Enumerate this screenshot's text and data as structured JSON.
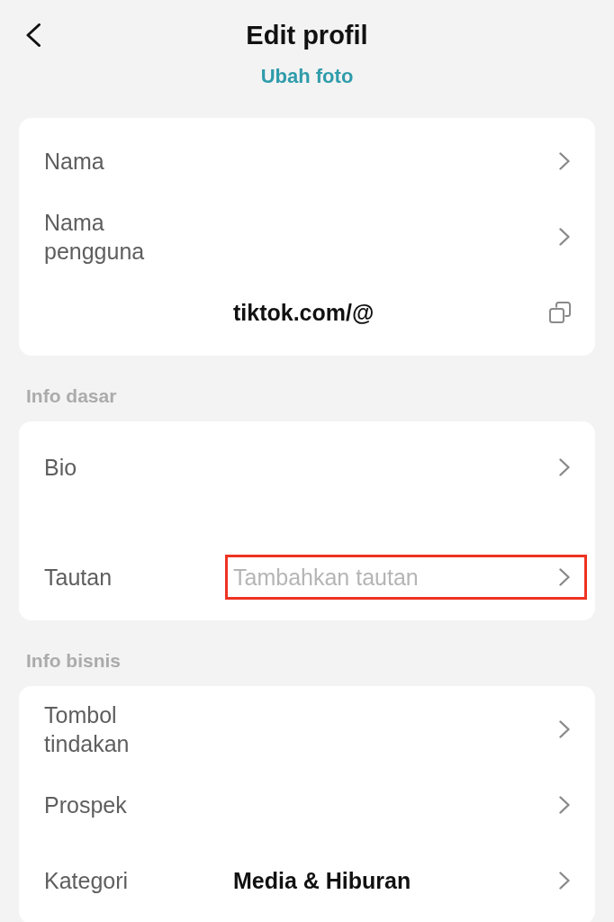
{
  "header": {
    "title": "Edit profil"
  },
  "photo_link": {
    "label": "Ubah foto"
  },
  "sections": [
    {
      "rows": [
        {
          "kind": "nav",
          "label": "Nama",
          "highlighted": false
        },
        {
          "kind": "nav",
          "label": "Nama pengguna",
          "highlighted": false
        },
        {
          "kind": "copy",
          "value": "tiktok.com/@",
          "highlighted": false
        }
      ]
    },
    {
      "title": "Info dasar",
      "rows": [
        {
          "kind": "textarea",
          "label": "Bio",
          "highlighted": false
        },
        {
          "kind": "nav",
          "label": "Tautan",
          "hint": "Tambahkan tautan",
          "highlighted": true
        }
      ]
    },
    {
      "title": "Info bisnis",
      "rows": [
        {
          "kind": "nav",
          "label": "Tombol tindakan",
          "highlighted": false
        },
        {
          "kind": "nav",
          "label": "Prospek",
          "highlighted": false
        },
        {
          "kind": "nav",
          "label": "Kategori",
          "value": "Media & Hiburan",
          "highlighted": false
        }
      ]
    }
  ]
}
